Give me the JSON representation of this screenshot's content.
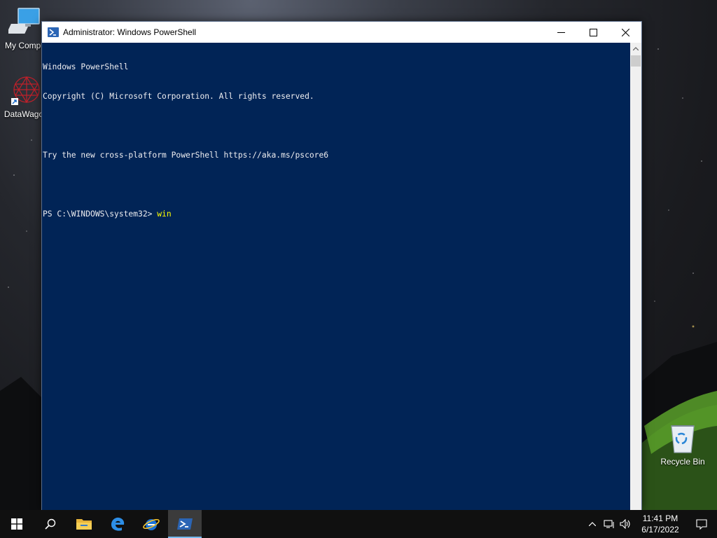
{
  "desktop": {
    "icons": [
      {
        "label": "My Compu"
      },
      {
        "label": "DataWagor"
      },
      {
        "label": "Recycle Bin"
      }
    ]
  },
  "window": {
    "title": "Administrator: Windows PowerShell",
    "console": {
      "lines": [
        "Windows PowerShell",
        "Copyright (C) Microsoft Corporation. All rights reserved.",
        "",
        "Try the new cross-platform PowerShell https://aka.ms/pscore6",
        ""
      ],
      "prompt": "PS C:\\WINDOWS\\system32> ",
      "command": "win"
    },
    "colors": {
      "console_bg": "#012456",
      "console_fg": "#eeedf0",
      "command_fg": "#ffff00"
    }
  },
  "taskbar": {
    "apps": [
      {
        "name": "start-icon"
      },
      {
        "name": "search-icon"
      },
      {
        "name": "file-explorer-icon"
      },
      {
        "name": "edge-legacy-icon"
      },
      {
        "name": "internet-explorer-icon"
      },
      {
        "name": "powershell-icon",
        "active": true
      }
    ],
    "clock": {
      "time": "11:41 PM",
      "date": "6/17/2022"
    }
  }
}
